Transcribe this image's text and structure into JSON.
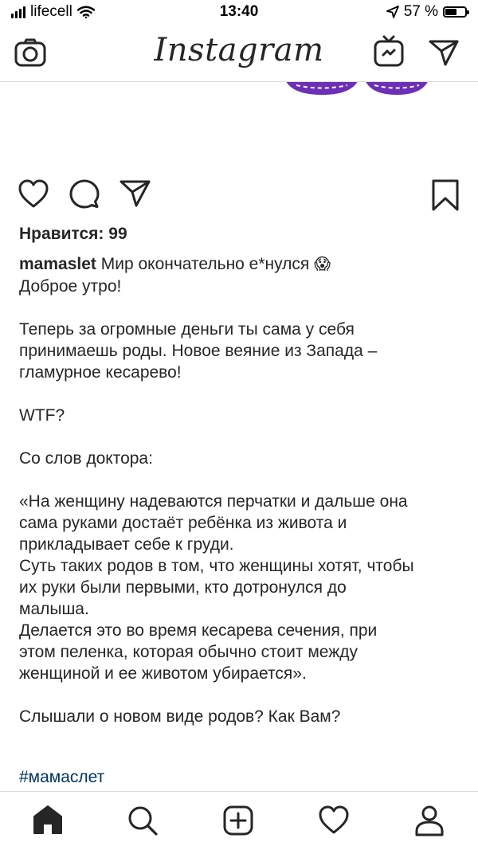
{
  "status_bar": {
    "carrier": "lifecell",
    "time": "13:40",
    "battery": "57 %"
  },
  "header": {
    "logo": "Instagram",
    "icons": [
      "camera-icon",
      "igtv-icon",
      "direct-send-icon"
    ]
  },
  "post": {
    "image_colors": {
      "purple": "#6c2fb8",
      "dash": "#ffffff"
    },
    "likes": "Нравится: 99",
    "caption": {
      "username": "mamaslet",
      "first_line": "Мир окончательно е*нулся",
      "emoji": "😱",
      "lines": [
        "Доброе утро!",
        "",
        "Теперь за огромные деньги ты сама у себя",
        "принимаешь роды.  Новое веяние из Запада –",
        "гламурное кесарево!",
        "",
        "WTF?",
        "",
        "Со слов доктора:",
        "",
        "«На женщину надеваются перчатки и дальше она",
        "сама руками достаёт ребёнка из живота и",
        "прикладывает себе к груди.",
        "Суть таких родов в том, что женщины хотят, чтобы",
        "их руки были первыми, кто дотронулся до",
        "малыша.",
        "Делается это во время кесарева сечения, при",
        "этом пеленка, которая обычно стоит между",
        "женщиной и ее животом убирается».",
        "",
        "Слышали о новом виде родов? Как Вам?"
      ],
      "hashtag": "#мамаслет"
    }
  },
  "tab_bar": {
    "items": [
      "home-icon",
      "search-icon",
      "add-post-icon",
      "activity-heart-icon",
      "profile-icon"
    ]
  },
  "colors": {
    "text": "#262626",
    "hashtag": "#003569",
    "divider": "#dbdbdb"
  }
}
